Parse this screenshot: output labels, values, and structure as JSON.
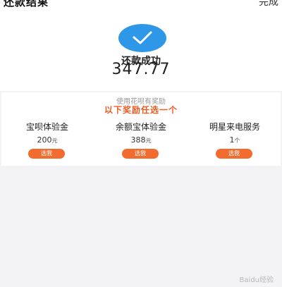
{
  "header": {
    "title": "还款结果",
    "done_label": "完成"
  },
  "status": {
    "icon": "checkmark-icon",
    "label": "还款成功",
    "amount": "347.77"
  },
  "rewards": {
    "subtitle": "使用花呗有奖励",
    "title": "以下奖励任选一个",
    "items": [
      {
        "name": "宝呗体验金",
        "value": "200",
        "unit": "元",
        "button": "选我"
      },
      {
        "name": "余额宝体验金",
        "value": "388",
        "unit": "元",
        "button": "选我"
      },
      {
        "name": "明星来电服务",
        "value": "1",
        "unit": "个",
        "button": "选我"
      }
    ]
  },
  "watermark": "Baidu经验",
  "colors": {
    "accent_blue": "#2f97e8",
    "accent_orange": "#f26c2f",
    "title_orange": "#f05a1e",
    "background": "#f3f3f5"
  }
}
